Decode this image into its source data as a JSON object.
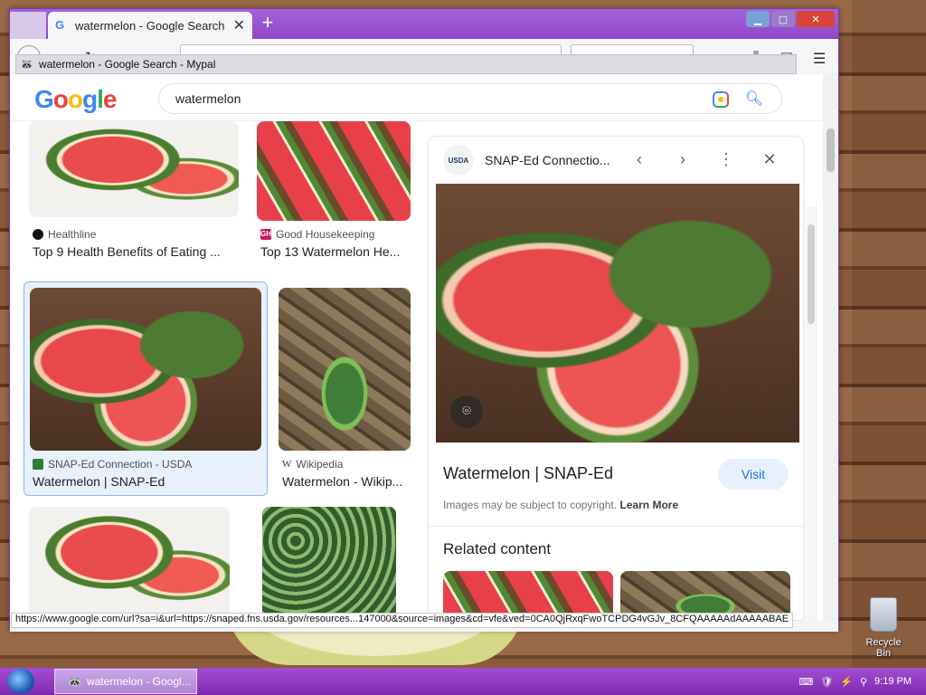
{
  "browser": {
    "tab_title": "watermelon - Google Search",
    "tooltip_title": "watermelon - Google Search - Mypal",
    "status_url": "https://www.google.com/url?sa=i&url=https://snaped.fns.usda.gov/resources...147000&source=images&cd=vfe&ved=0CA0QjRxqFwoTCPDG4vGJv_8CFQAAAAAdAAAAABAE"
  },
  "google": {
    "logo": [
      "G",
      "o",
      "o",
      "g",
      "l",
      "e"
    ],
    "query": "watermelon"
  },
  "results": [
    {
      "source": "Healthline",
      "title": "Top 9 Health Benefits of Eating ..."
    },
    {
      "source": "Good Housekeeping",
      "title": "Top 13 Watermelon He..."
    },
    {
      "source": "SNAP-Ed Connection - USDA",
      "title": "Watermelon | SNAP-Ed"
    },
    {
      "source": "Wikipedia",
      "title": "Watermelon - Wikip..."
    }
  ],
  "panel": {
    "source": "SNAP-Ed Connectio...",
    "logo_text": "USDA",
    "title": "Watermelon | SNAP-Ed",
    "visit_label": "Visit",
    "copyright_text": "Images may be subject to copyright.",
    "learn_more": "Learn More",
    "related_heading": "Related content"
  },
  "desktop": {
    "recycle_bin_label": "Recycle Bin"
  },
  "taskbar": {
    "task_label": "watermelon - Googl...",
    "clock": "9:19 PM"
  },
  "colors": {
    "titlebar": "#8f47c9",
    "taskbar": "#8a36bf",
    "link_blue": "#1a73e8",
    "selected_border": "#8ab4f8"
  }
}
